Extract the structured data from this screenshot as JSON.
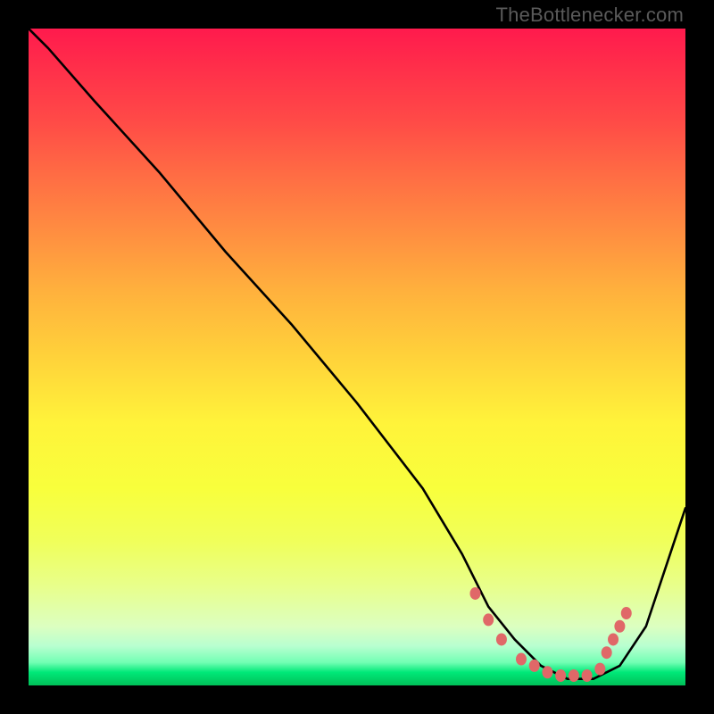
{
  "watermark": "TheBottlenecker.com",
  "chart_data": {
    "type": "line",
    "title": "",
    "xlabel": "",
    "ylabel": "",
    "xlim": [
      0,
      100
    ],
    "ylim": [
      0,
      100
    ],
    "background": "red-yellow-green vertical gradient",
    "curve_color": "#000000",
    "marker_color": "#e06868",
    "series": [
      {
        "name": "bottleneck-curve",
        "x": [
          0,
          3,
          10,
          20,
          30,
          40,
          50,
          60,
          66,
          70,
          74,
          78,
          82,
          86,
          90,
          94,
          100
        ],
        "y": [
          100,
          97,
          89,
          78,
          66,
          55,
          43,
          30,
          20,
          12,
          7,
          3,
          1,
          1,
          3,
          9,
          27
        ]
      }
    ],
    "markers": {
      "name": "optimal-band-dots",
      "points": [
        {
          "x": 68,
          "y": 14
        },
        {
          "x": 70,
          "y": 10
        },
        {
          "x": 72,
          "y": 7
        },
        {
          "x": 75,
          "y": 4
        },
        {
          "x": 77,
          "y": 3
        },
        {
          "x": 79,
          "y": 2
        },
        {
          "x": 81,
          "y": 1.5
        },
        {
          "x": 83,
          "y": 1.5
        },
        {
          "x": 85,
          "y": 1.5
        },
        {
          "x": 87,
          "y": 2.5
        },
        {
          "x": 88,
          "y": 5
        },
        {
          "x": 89,
          "y": 7
        },
        {
          "x": 90,
          "y": 9
        },
        {
          "x": 91,
          "y": 11
        }
      ]
    }
  }
}
